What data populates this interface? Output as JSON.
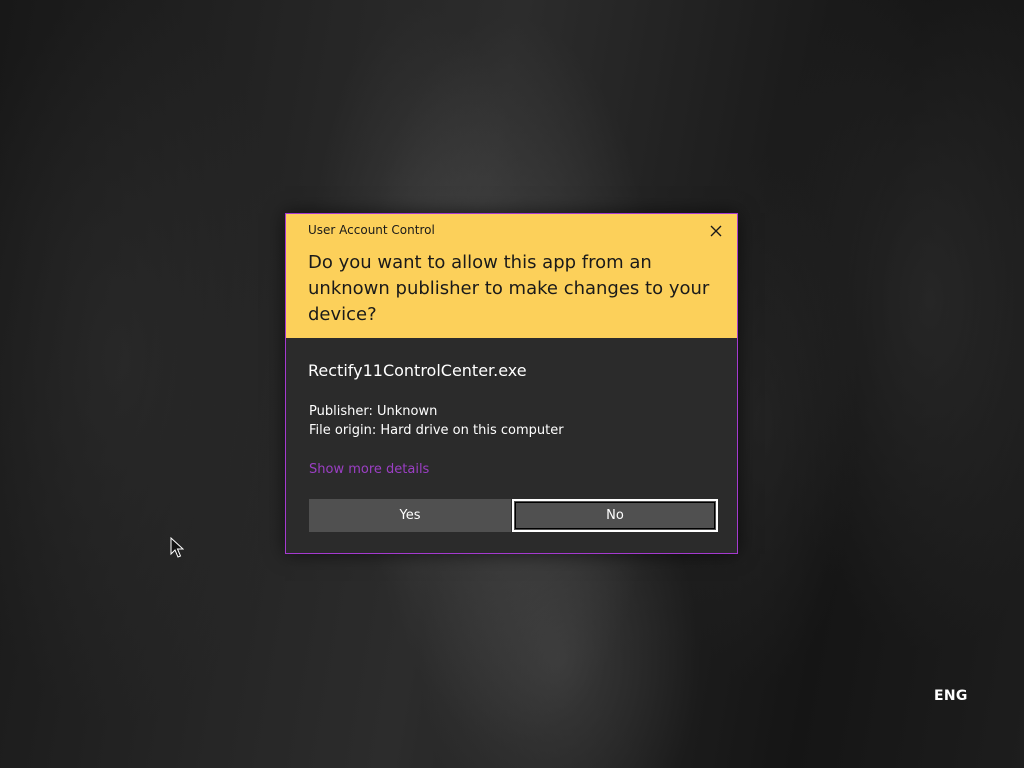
{
  "dialog": {
    "title": "User Account Control",
    "question": "Do you want to allow this app from an unknown publisher to make changes to your device?",
    "app_name": "Rectify11ControlCenter.exe",
    "publisher": "Publisher: Unknown",
    "file_origin": "File origin: Hard drive on this computer",
    "details_link": "Show more details",
    "yes_label": "Yes",
    "no_label": "No",
    "close_icon": "close-icon",
    "colors": {
      "header": "#fcd05a",
      "body": "#2b2b2b",
      "border": "#a53ad0",
      "link": "#9b3fc4"
    }
  },
  "taskbar": {
    "language": "ENG"
  },
  "cursor": {
    "icon": "mouse-pointer-icon"
  }
}
